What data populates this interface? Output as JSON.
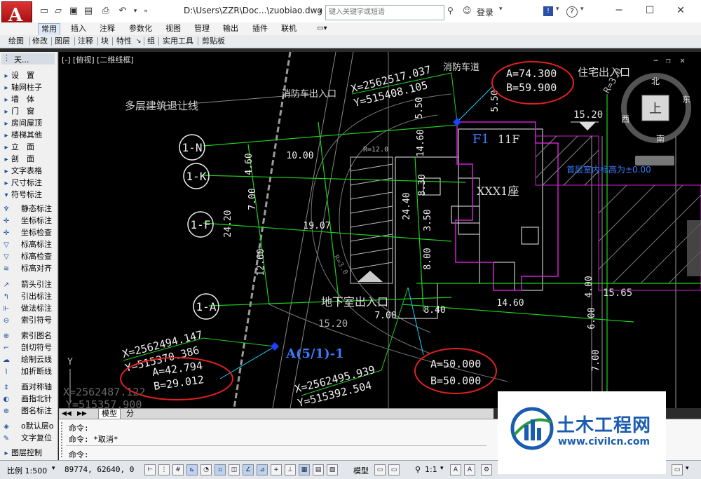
{
  "app": {
    "logo_letter": "A"
  },
  "titlebar": {
    "doc_title": "D:\\Users\\ZZR\\Doc...\\zuobiao.dwg",
    "search_placeholder": "键入关键字或短语",
    "login_label": "登录"
  },
  "ribbon": {
    "tabs": [
      {
        "label": "常用"
      },
      {
        "label": "插入"
      },
      {
        "label": "注释"
      },
      {
        "label": "参数化"
      },
      {
        "label": "视图"
      },
      {
        "label": "管理"
      },
      {
        "label": "输出"
      },
      {
        "label": "插件"
      },
      {
        "label": "联机"
      }
    ],
    "panels": [
      {
        "label": "绘图"
      },
      {
        "label": "修改"
      },
      {
        "label": "图层"
      },
      {
        "label": "注释"
      },
      {
        "label": "块"
      },
      {
        "label": "特性"
      },
      {
        "label": "组"
      },
      {
        "label": "实用工具"
      },
      {
        "label": "剪贴板"
      }
    ]
  },
  "palette": {
    "title": "天...",
    "items": [
      {
        "label": "设　置",
        "icon": "triangle"
      },
      {
        "label": "轴网柱子",
        "icon": "triangle"
      },
      {
        "label": "墙　体",
        "icon": "triangle"
      },
      {
        "label": "门　窗",
        "icon": "triangle"
      },
      {
        "label": "房间屋顶",
        "icon": "triangle"
      },
      {
        "label": "楼梯其他",
        "icon": "triangle"
      },
      {
        "label": "立　面",
        "icon": "triangle"
      },
      {
        "label": "剖　面",
        "icon": "triangle"
      },
      {
        "label": "文字表格",
        "icon": "triangle"
      },
      {
        "label": "尺寸标注",
        "icon": "triangle"
      },
      {
        "label": "符号标注",
        "icon": "triangle-down"
      },
      {
        "label": "静态标注",
        "icon": "pin"
      },
      {
        "label": "坐标标注",
        "icon": "coord"
      },
      {
        "label": "坐标检查",
        "icon": "coord"
      },
      {
        "label": "标高标注",
        "icon": "elev"
      },
      {
        "label": "标高检查",
        "icon": "elev"
      },
      {
        "label": "标高对齐",
        "icon": "elev"
      },
      {
        "label": "箭头引注",
        "icon": "arrow"
      },
      {
        "label": "引出标注",
        "icon": "arrow"
      },
      {
        "label": "做法标注",
        "icon": "arrow"
      },
      {
        "label": "索引符号",
        "icon": "arrow"
      },
      {
        "label": "索引图名",
        "icon": "circle"
      },
      {
        "label": "剖切符号",
        "icon": "section"
      },
      {
        "label": "绘制云线",
        "icon": "cloud"
      },
      {
        "label": "加折断线",
        "icon": "break"
      },
      {
        "label": "画对称轴",
        "icon": "axis"
      },
      {
        "label": "画指北针",
        "icon": "north"
      },
      {
        "label": "图名标注",
        "icon": "circle"
      },
      {
        "label": "o默认层o",
        "icon": "layer"
      },
      {
        "label": "文字复位",
        "icon": "text"
      },
      {
        "label": "图层控制",
        "icon": "triangle"
      }
    ]
  },
  "viewport": {
    "label": "[-] [俯视] [二维线框]"
  },
  "drawing": {
    "grid_labels": [
      "1-N",
      "1-K",
      "1-F",
      "1-A"
    ],
    "dims_vertical": [
      "4.60",
      "7.00",
      "24.20",
      "12.60",
      "5.50",
      "14.60",
      "8.30",
      "24.40",
      "3.50",
      "8.00",
      "5.50",
      "4.00",
      "6.00",
      "7.00"
    ],
    "dims_horizontal": [
      "10.00",
      "19.07",
      "7.00",
      "8.40",
      "14.60"
    ],
    "texts": {
      "setback": "多层建筑退让线",
      "fire_entrance": "消防车出入口",
      "fire_road": "消防车道",
      "resident_entrance": "住宅出入口",
      "basement_entrance": "地下室出入口",
      "building": "XXX1座",
      "floor_label": "F1",
      "floors": "11F",
      "level_1": "15.20",
      "level_2": "15.20",
      "level_3": "15.65",
      "radius_1": "R=12.0",
      "radius_2": "R=3.0",
      "radius_3": "R=3.0",
      "room_text": "首层室内标高为±0.00",
      "axis_ref": "A(5/1)-1",
      "y_axis": "Y"
    },
    "coords": [
      {
        "x": "X=2562517.037",
        "y": "Y=515408.105"
      },
      {
        "x": "X=2562494.147",
        "y": "Y=515370.386"
      },
      {
        "x": "X=2562495.939",
        "y": "Y=515392.504"
      },
      {
        "x": "X=2562487.122",
        "y": "Y=515357.900"
      }
    ],
    "ab_labels": [
      {
        "a": "A=74.300",
        "b": "B=59.900"
      },
      {
        "a": "A=42.794",
        "b": "B=29.012"
      },
      {
        "a": "A=50.000",
        "b": "B=50.000"
      }
    ],
    "viewcube": {
      "top": "上",
      "north": "北",
      "south": "南",
      "west": "西",
      "east": "东"
    }
  },
  "model_tabs": {
    "model": "模型",
    "layout": "分"
  },
  "command": {
    "lines": [
      "命令:",
      "命令: *取消*"
    ],
    "prompt": "命令:"
  },
  "status": {
    "scale": "比例 1:500",
    "coords": "89774, 62640, 0",
    "model_label": "模型",
    "annot_scale": "1:1"
  },
  "watermark": {
    "name": "土木工程网",
    "url": "www.civilcn.com"
  },
  "colors": {
    "canvas": "#000000",
    "green": "#20d020",
    "red_ellipse": "#e02020",
    "magenta": "#d020d0",
    "accent": "#1a5cb0"
  }
}
